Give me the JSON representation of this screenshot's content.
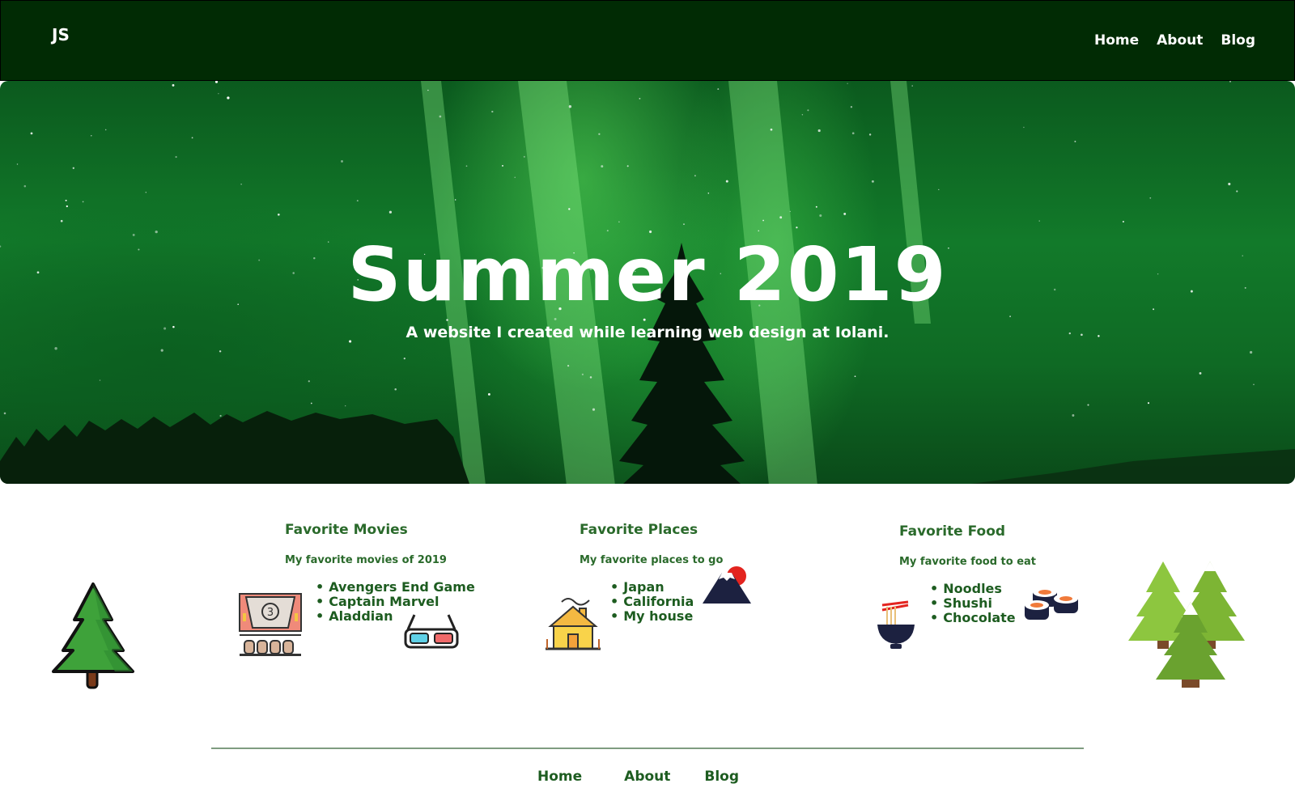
{
  "header": {
    "logo": "JS",
    "nav": [
      "Home",
      "About",
      "Blog"
    ]
  },
  "hero": {
    "title": "Summer 2019",
    "subtitle": "A website I created while learning web design at Iolani."
  },
  "sections": {
    "movies": {
      "title": "Favorite Movies",
      "description": "My favorite movies of 2019",
      "items": [
        "Avengers End Game",
        "Captain Marvel",
        "Aladdian"
      ]
    },
    "places": {
      "title": "Favorite Places",
      "description": "My favorite places to go",
      "items": [
        "Japan",
        "California",
        "My house"
      ]
    },
    "food": {
      "title": "Favorite Food",
      "description": "My favorite food to eat",
      "items": [
        "Noodles",
        "Shushi",
        "Chocolate"
      ]
    }
  },
  "footer": {
    "nav": [
      "Home",
      "About",
      "Blog"
    ]
  },
  "colors": {
    "header_bg": "#012b04",
    "text_green": "#1d5c20",
    "tree_green": "#3ea23a"
  }
}
